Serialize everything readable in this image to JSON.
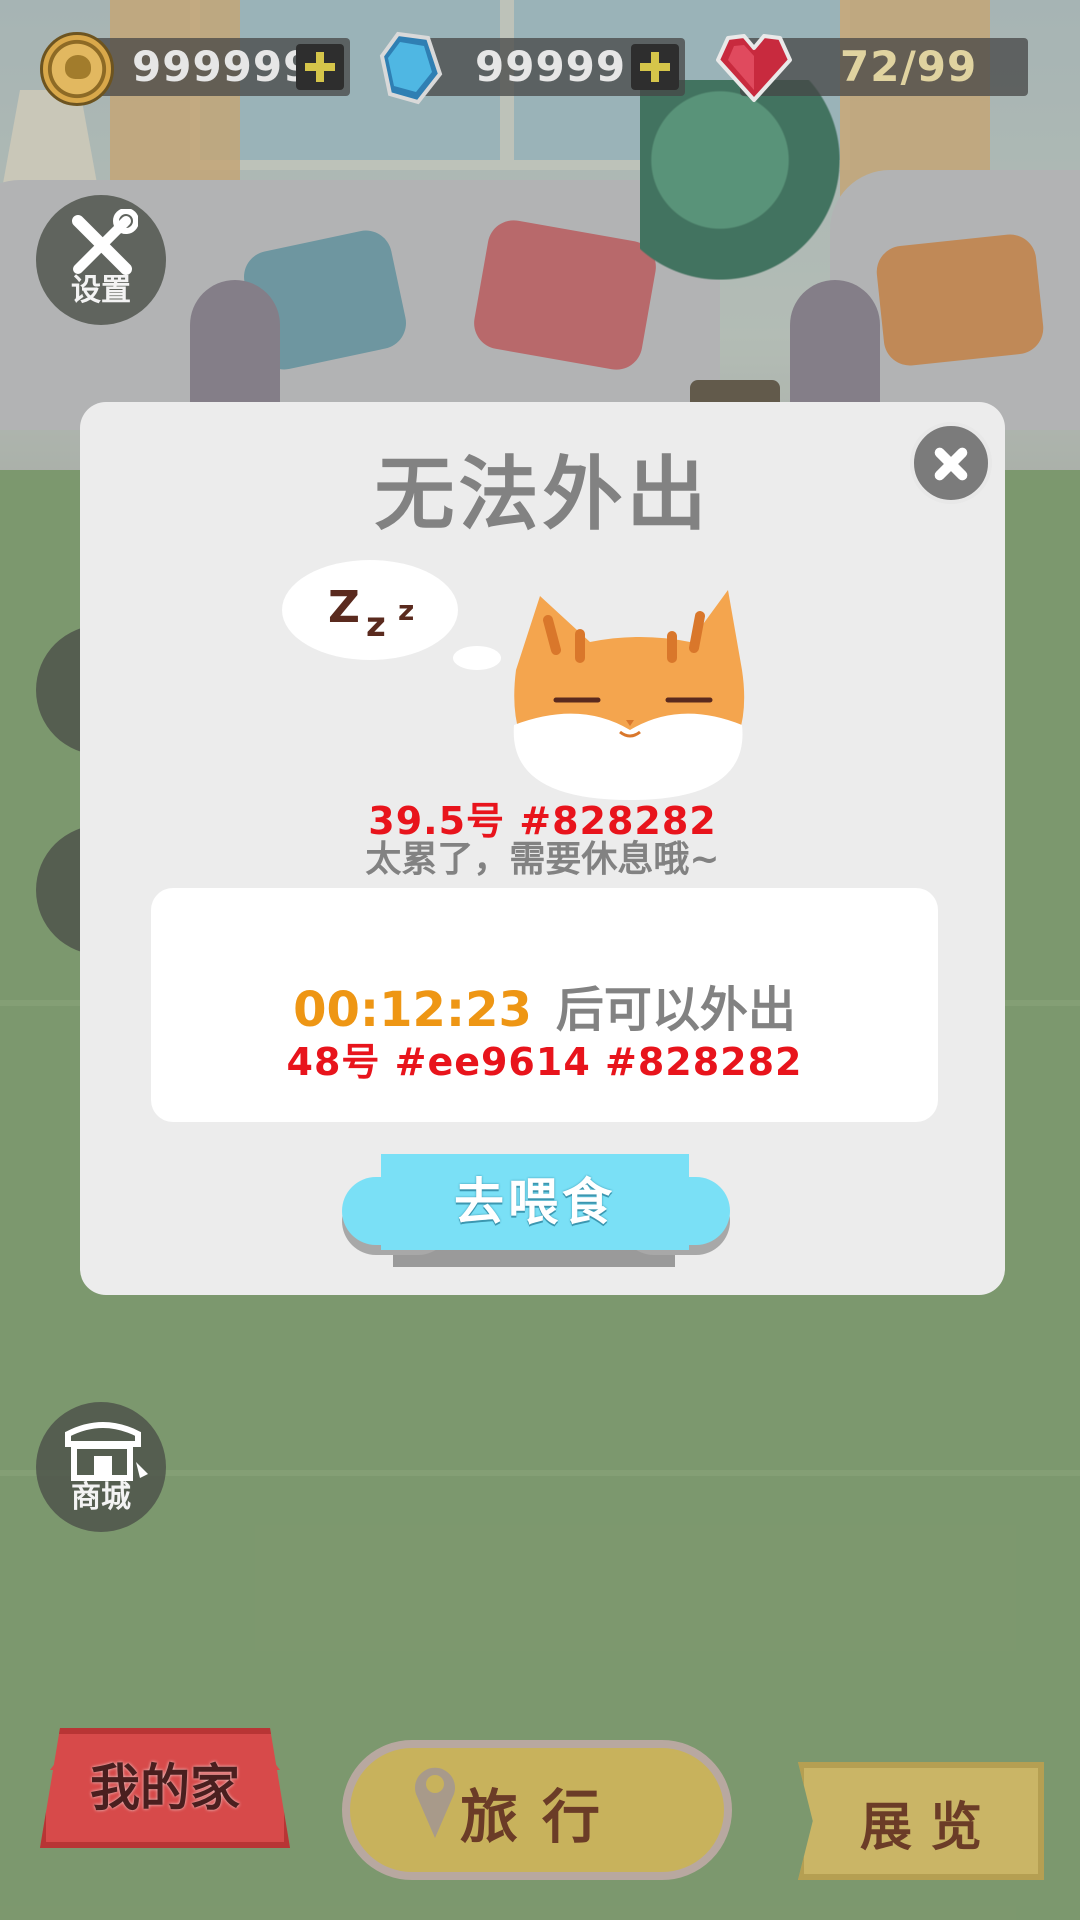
{
  "resources": {
    "coins": "999999",
    "gems": "99999",
    "energy": "72/99"
  },
  "side_buttons": {
    "settings_label": "设置",
    "shop_label": "商城"
  },
  "modal": {
    "title": "无法外出",
    "size_note_1": "39.5号  #828282",
    "subtitle": "太累了，需要休息哦~",
    "timer": "00:12:23",
    "timer_suffix": "后可以外出",
    "size_note_2": "48号  #ee9614  #828282",
    "feed_button": "去喂食"
  },
  "bottom_nav": {
    "home": "我的家",
    "travel": "旅行",
    "exhibit": "展览"
  },
  "colors": {
    "title_gray": "#828282",
    "timer_orange": "#ee9614",
    "note_red": "#e8141c",
    "button_cyan": "#7ae0f6"
  },
  "icons": [
    "coin-icon",
    "gem-icon",
    "heart-icon",
    "wrench-screwdriver-icon",
    "store-icon",
    "close-icon",
    "sleeping-cat-icon",
    "location-pin-icon"
  ]
}
